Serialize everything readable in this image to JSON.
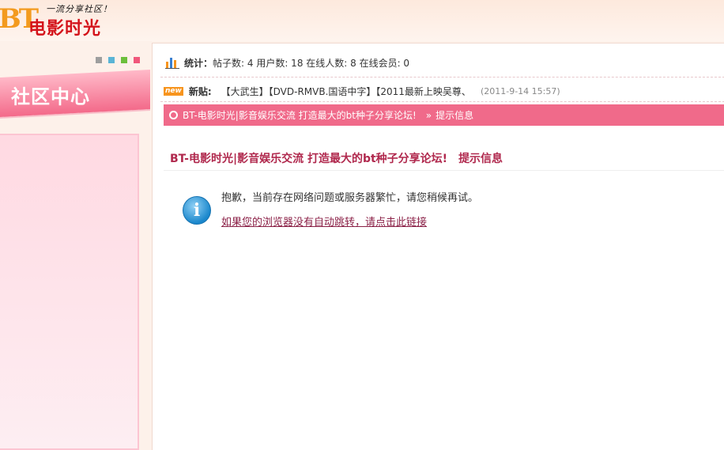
{
  "header": {
    "logo_mark": "BT",
    "logo_name": "电影时光",
    "logo_slogan": "一流分享社区！"
  },
  "sidebar": {
    "dots": [
      {
        "color": "#9e9e9e",
        "icon": "square-gray"
      },
      {
        "color": "#5ab4d6",
        "icon": "square-blue"
      },
      {
        "color": "#6cbf3c",
        "icon": "square-green"
      },
      {
        "color": "#f0577b",
        "icon": "square-pink"
      }
    ],
    "banner_title": "社区中心"
  },
  "stats": {
    "icon": "bar-chart-icon",
    "label": "统计：",
    "text": "帖子数: 4 用户数: 18 在线人数: 8 在线会员: 0"
  },
  "news": {
    "badge": "new",
    "label": "新贴:",
    "link": "【大武生】【DVD-RMVB.国语中字】【2011最新上映吴尊、",
    "time": "(2011-9-14 15:57)"
  },
  "breadcrumb": {
    "site": "BT-电影时光|影音娱乐交流 打造最大的bt种子分享论坛!",
    "separator": "»",
    "current": "提示信息"
  },
  "message": {
    "title": "BT-电影时光|影音娱乐交流 打造最大的bt种子分享论坛!",
    "title_suffix": "提示信息",
    "icon": "info-icon",
    "text": "抱歉，当前存在网络问题或服务器繁忙，请您稍候再试。",
    "link": "如果您的浏览器没有自动跳转，请点击此链接"
  },
  "colors": {
    "accent_pink": "#f06a8a",
    "title_red": "#b0284d",
    "logo_red": "#d4141b",
    "logo_orange": "#f39a1e"
  }
}
